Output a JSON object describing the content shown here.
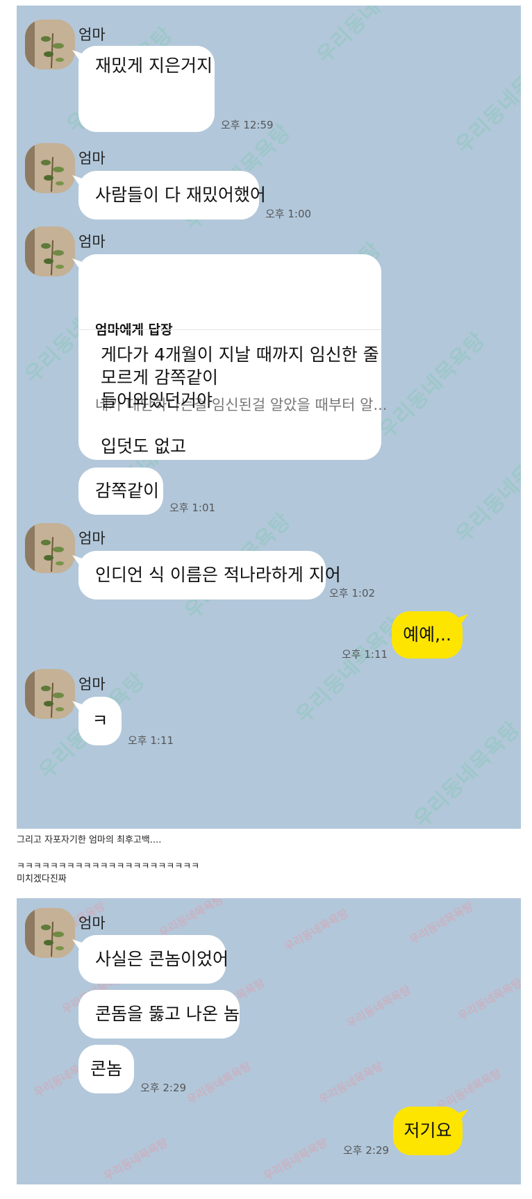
{
  "sender_name": "엄마",
  "messages": {
    "m1": {
      "text": "재밌게 지은거지",
      "time": "오후 12:59"
    },
    "m2": {
      "text": "사람들이 다 재밌어했어",
      "time": "오후 1:00"
    },
    "m3": {
      "reply_title": "엄마에게 답장",
      "reply_quote": "네가 대단하다는걸 임신된걸 알았을 때부터 알...",
      "text": "게다가 4개월이 지날 때까지 임신한 줄\n모르게 감쪽같이\n들어와있던거야\n\n입덧도 없고"
    },
    "m4": {
      "text": "감쪽같이",
      "time": "오후 1:01"
    },
    "m5": {
      "text": "인디언 식 이름은 적나라하게 지어",
      "time": "오후 1:02"
    },
    "m6": {
      "text": "예예,..",
      "time": "오후 1:11"
    },
    "m7": {
      "text": "ㅋ",
      "time": "오후 1:11"
    },
    "m8": {
      "text": "사실은 콘놈이었어"
    },
    "m9": {
      "text": "콘돔을 뚫고 나온 놈"
    },
    "m10": {
      "text": "콘놈",
      "time": "오후 2:29"
    },
    "m11": {
      "text": "저기요",
      "time": "오후 2:29"
    }
  },
  "caption": {
    "line1": "그리고 자포자기한 엄마의 최후고백....",
    "line2": "ㅋㅋㅋㅋㅋㅋㅋㅋㅋㅋㅋㅋㅋㅋㅋㅋㅋㅋㅋㅋㅋㅋ",
    "line3": "미치겠다진짜"
  },
  "watermark": "우리동네목욕탕",
  "colors": {
    "chat_bg": "#b2c7da",
    "my_bubble": "#fee500",
    "other_bubble": "#ffffff"
  }
}
